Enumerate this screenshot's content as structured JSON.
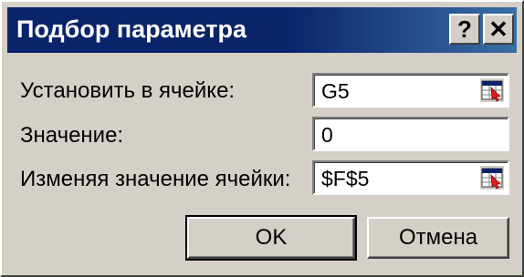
{
  "window": {
    "title": "Подбор параметра",
    "help_label": "?",
    "close_label": "✕"
  },
  "fields": {
    "set_cell": {
      "label": "Установить в ячейке:",
      "value": "G5"
    },
    "to_value": {
      "label": "Значение:",
      "value": "0"
    },
    "by_changing": {
      "label": "Изменяя значение ячейки:",
      "value": "$F$5"
    }
  },
  "buttons": {
    "ok_label": "OK",
    "cancel_label": "Отмена"
  },
  "colors": {
    "titlebar": "#0a246a",
    "dialog_face": "#d4d0c8"
  },
  "icons": {
    "ref_button": "collapse-dialog-range-icon"
  }
}
